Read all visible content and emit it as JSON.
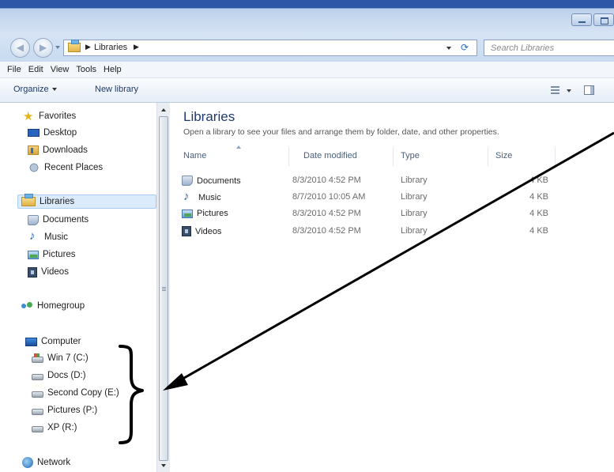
{
  "address": {
    "breadcrumb": "Libraries",
    "search_placeholder": "Search Libraries"
  },
  "menu": [
    "File",
    "Edit",
    "View",
    "Tools",
    "Help"
  ],
  "toolbar": {
    "organize_label": "Organize",
    "new_library_label": "New library"
  },
  "nav": {
    "favorites": {
      "label": "Favorites",
      "items": [
        "Desktop",
        "Downloads",
        "Recent Places"
      ]
    },
    "libraries": {
      "label": "Libraries",
      "items": [
        "Documents",
        "Music",
        "Pictures",
        "Videos"
      ]
    },
    "homegroup": "Homegroup",
    "computer": {
      "label": "Computer",
      "drives": [
        "Win 7 (C:)",
        "Docs (D:)",
        "Second Copy (E:)",
        "Pictures (P:)",
        "XP (R:)"
      ]
    },
    "network": "Network"
  },
  "content": {
    "title": "Libraries",
    "description": "Open a library to see your files and arrange them by folder, date, and other properties.",
    "columns": {
      "name": "Name",
      "date": "Date modified",
      "type": "Type",
      "size": "Size"
    },
    "rows": [
      {
        "icon": "documents-icon",
        "name": "Documents",
        "date": "8/3/2010 4:52 PM",
        "type": "Library",
        "size": "4 KB"
      },
      {
        "icon": "music-icon",
        "name": "Music",
        "date": "8/7/2010 10:05 AM",
        "type": "Library",
        "size": "4 KB"
      },
      {
        "icon": "pictures-icon",
        "name": "Pictures",
        "date": "8/3/2010 4:52 PM",
        "type": "Library",
        "size": "4 KB"
      },
      {
        "icon": "videos-icon",
        "name": "Videos",
        "date": "8/3/2010 4:52 PM",
        "type": "Library",
        "size": "4 KB"
      }
    ]
  },
  "colors": {
    "title_accent": "#1e3a6e",
    "selection_bg": "#dcebfc",
    "chrome_blue": "#2f57a8"
  }
}
